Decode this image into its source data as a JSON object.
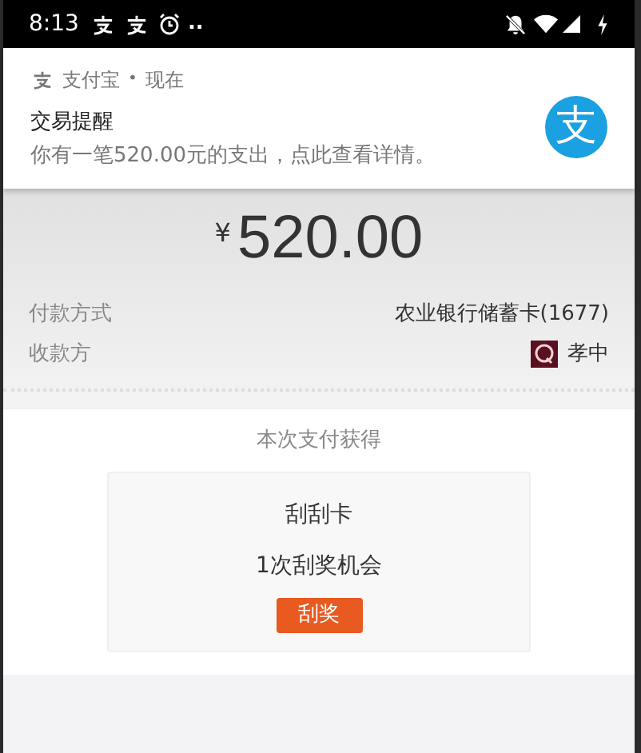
{
  "status_bar": {
    "time": "8:13",
    "dots": ".."
  },
  "notification": {
    "app_name": "支付宝",
    "separator": "•",
    "time": "现在",
    "title": "交易提醒",
    "body": "你有一笔520.00元的支出，点此查看详情。",
    "logo_glyph": "支"
  },
  "result": {
    "currency": "¥",
    "amount": "520.00"
  },
  "details": [
    {
      "label": "付款方式",
      "value": "农业银行储蓄卡(1677)",
      "kind": "text"
    },
    {
      "label": "收款方",
      "value": "孝中",
      "kind": "avatar"
    }
  ],
  "reward": {
    "heading": "本次支付获得",
    "card_title": "刮刮卡",
    "card_subtitle": "1次刮奖机会",
    "button": "刮奖"
  }
}
